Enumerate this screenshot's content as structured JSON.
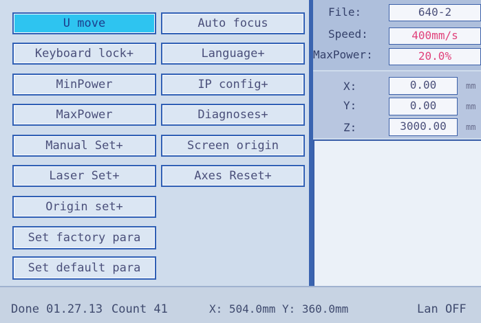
{
  "left_buttons": [
    {
      "label": "U move"
    },
    {
      "label": "Keyboard lock+"
    },
    {
      "label": "MinPower"
    },
    {
      "label": "MaxPower"
    },
    {
      "label": "Manual Set+"
    },
    {
      "label": "Laser Set+"
    },
    {
      "label": "Origin set+"
    },
    {
      "label": "Set factory para"
    },
    {
      "label": "Set default para"
    }
  ],
  "right_buttons": [
    {
      "label": "Auto focus"
    },
    {
      "label": "Language+"
    },
    {
      "label": "IP config+"
    },
    {
      "label": "Diagnoses+"
    },
    {
      "label": "Screen origin"
    },
    {
      "label": "Axes Reset+"
    }
  ],
  "file_info": {
    "file_label": "File:",
    "file_value": "640-2",
    "speed_label": "Speed:",
    "speed_value": "400mm/s",
    "maxpower_label": "MaxPower:",
    "maxpower_value": "20.0%"
  },
  "axes": {
    "x_label": "X:",
    "x_value": "0.00",
    "x_unit": "mm",
    "y_label": "Y:",
    "y_value": "0.00",
    "y_unit": "mm",
    "z_label": "Z:",
    "z_value": "3000.00",
    "z_unit": "mm"
  },
  "status": {
    "done": "Done 01.27.13",
    "count": "Count   41",
    "coords": "X: 504.0mm Y: 360.0mm",
    "lan": "Lan OFF"
  },
  "colors": {
    "active_button": "#2ec4f0",
    "button_border": "#2f5fb5",
    "speed_value": "#e0407a",
    "maxpower_value": "#e0407a"
  }
}
